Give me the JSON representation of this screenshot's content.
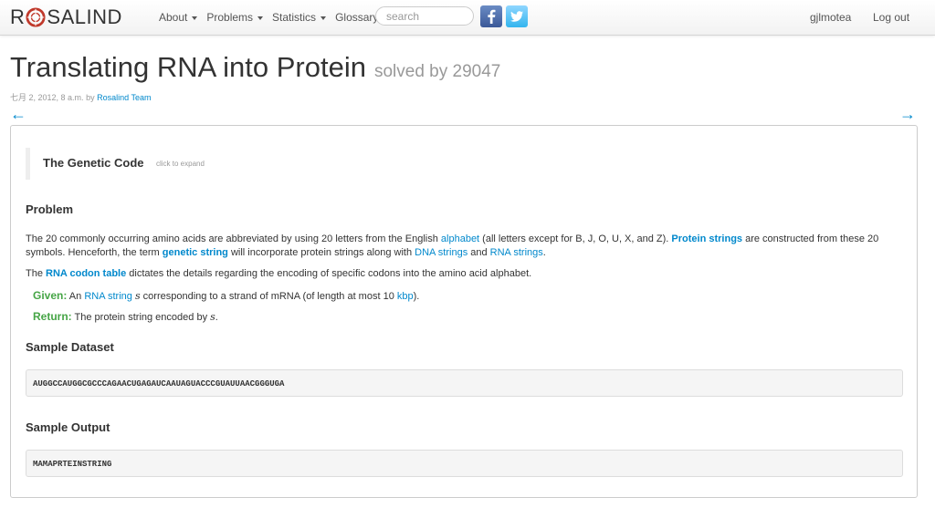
{
  "brand": {
    "left": "R",
    "right": "SALIND"
  },
  "nav": {
    "about": "About",
    "problems": "Problems",
    "statistics": "Statistics",
    "glossary": "Glossary"
  },
  "search": {
    "placeholder": "search"
  },
  "user": {
    "name": "gjlmotea",
    "logout": "Log out"
  },
  "problem": {
    "title": "Translating RNA into Protein",
    "solved": "solved by 29047",
    "date": "七月 2, 2012, 8 a.m.",
    "by": "by",
    "author": "Rosalind Team",
    "prev_arrow": "←",
    "next_arrow": "→"
  },
  "genetic_code": {
    "title": "The Genetic Code",
    "hint": "click to expand"
  },
  "sections": {
    "problem": "Problem",
    "sample_dataset": "Sample Dataset",
    "sample_output": "Sample Output"
  },
  "paragraph1": {
    "t1": "The 20 commonly occurring amino acids are abbreviated by using 20 letters from the English ",
    "link_alphabet": "alphabet",
    "t2": " (all letters except for B, J, O, U, X, and Z). ",
    "link_protein_strings": "Protein strings",
    "t3": " are constructed from these 20 symbols. Henceforth, the term ",
    "link_genetic_string": "genetic string",
    "t4": " will incorporate protein strings along with ",
    "link_dna_strings": "DNA strings",
    "t5": " and ",
    "link_rna_strings": "RNA strings",
    "t6": "."
  },
  "paragraph2": {
    "t1": "The ",
    "link_rna_codon_table": "RNA codon table",
    "t2": " dictates the details regarding the encoding of specific codons into the amino acid alphabet."
  },
  "given": {
    "label": "Given:",
    "t1": " An ",
    "link_rna_string": "RNA string",
    "var": "s",
    "t2": " corresponding to a strand of mRNA (of length at most 10 ",
    "link_kbp": "kbp",
    "t3": ")."
  },
  "return": {
    "label": "Return:",
    "t1": " The protein string encoded by ",
    "var": "s",
    "t2": "."
  },
  "sample_dataset": "AUGGCCAUGGCGCCCAGAACUGAGAUCAAUAGUACCCGUAUUAACGGGUGA",
  "sample_output": "MAMAPRTEINSTRING",
  "colors": {
    "link": "#0088cc",
    "given_label": "#46a546",
    "facebook": "#3b5998",
    "twitter": "#33b5ee"
  },
  "icons": {
    "facebook": "facebook-icon",
    "twitter": "twitter-icon",
    "logo": "rosalind-logo-icon"
  }
}
